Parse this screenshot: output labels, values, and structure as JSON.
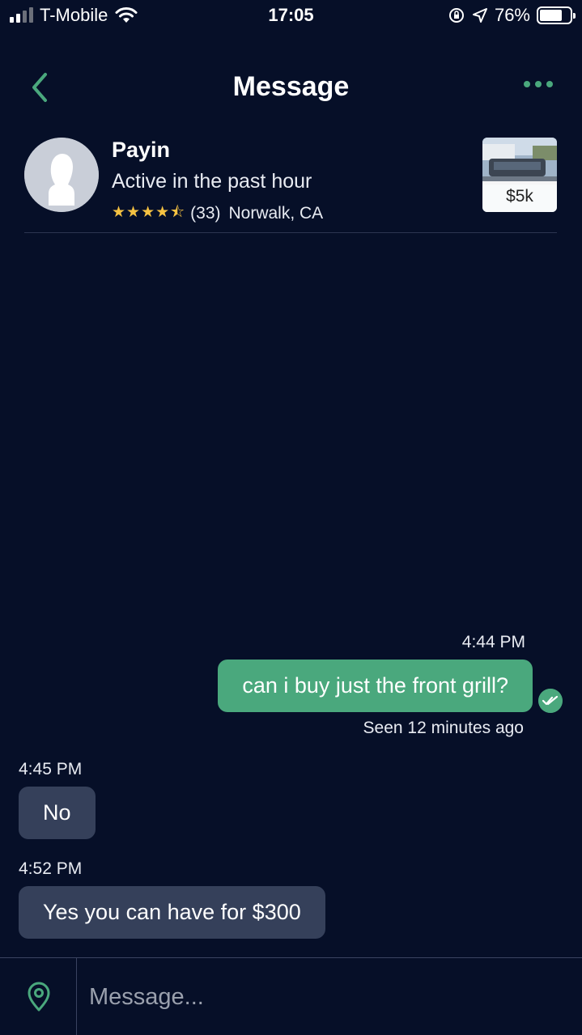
{
  "status_bar": {
    "carrier": "T-Mobile",
    "time": "17:05",
    "battery_percent": "76%",
    "battery_level": 0.76
  },
  "header": {
    "title": "Message",
    "back_icon": "chevron-left-icon",
    "more_icon": "more-dots-icon"
  },
  "profile": {
    "name": "Payin",
    "activity": "Active in the past hour",
    "rating": 4.5,
    "reviews": "(33)",
    "location": "Norwalk, CA"
  },
  "listing": {
    "price": "$5k"
  },
  "messages": [
    {
      "direction": "out",
      "time": "4:44 PM",
      "text": "can i buy just the front grill?",
      "status": "Seen 12 minutes ago"
    },
    {
      "direction": "in",
      "time": "4:45 PM",
      "text": "No"
    },
    {
      "direction": "in",
      "time": "4:52 PM",
      "text": "Yes you can have for $300"
    }
  ],
  "composer": {
    "placeholder": "Message...",
    "location_icon": "location-pin-icon"
  },
  "colors": {
    "background": "#060f28",
    "accent": "#4aa87d",
    "incoming_bubble": "#35405a",
    "star": "#f5c242"
  }
}
